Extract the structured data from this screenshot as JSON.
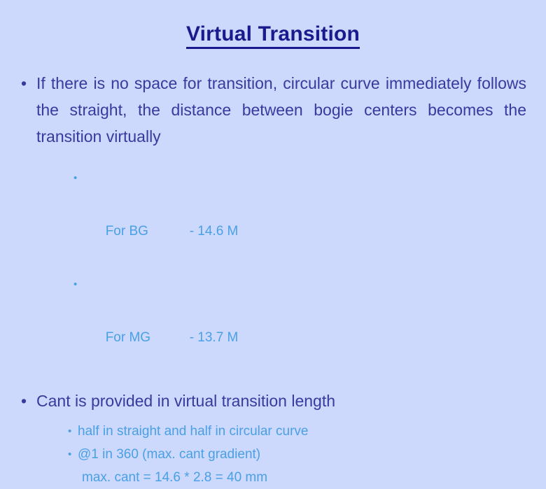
{
  "slide": {
    "title": "Virtual Transition",
    "bullet_glyph": "•",
    "colors": {
      "background": "#ccd8fc",
      "title": "#1a1a8c",
      "level1_text": "#3a3a9e",
      "level2_text": "#4aa0e4"
    },
    "content": {
      "bullet1": "If there is no space for transition, circular curve immediately follows the straight, the distance between bogie centers becomes the transition virtually",
      "gauge_rows": [
        {
          "label": "For BG",
          "value": "- 14.6 M"
        },
        {
          "label": "For MG",
          "value": "- 13.7 M"
        }
      ],
      "bullet2": "Cant is provided in virtual transition length",
      "sub_points": [
        "half in straight and half in circular curve",
        "@1 in 360 (max. cant gradient)"
      ],
      "calculation": "max. cant = 14.6 * 2.8 = 40 mm"
    }
  }
}
